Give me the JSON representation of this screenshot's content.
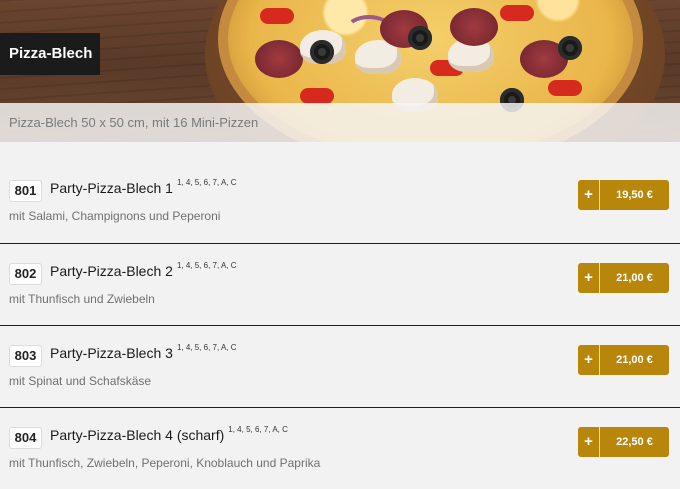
{
  "category": {
    "title": "Pizza-Blech",
    "subtitle": "Pizza-Blech 50 x 50 cm, mit 16 Mini-Pizzen"
  },
  "theme": {
    "accent": "#b8860b",
    "tag_bg": "#1b1b1b"
  },
  "icons": {
    "add": "plus-icon",
    "hero": "pizza-photo"
  },
  "items": [
    {
      "number": "801",
      "name": "Party-Pizza-Blech 1",
      "allergens": "1, 4, 5, 6, 7, A, C",
      "description": "mit Salami, Champignons und Peperoni",
      "plus": "+",
      "price": "19,50 €"
    },
    {
      "number": "802",
      "name": "Party-Pizza-Blech 2",
      "allergens": "1, 4, 5, 6, 7, A, C",
      "description": "mit Thunfisch und Zwiebeln",
      "plus": "+",
      "price": "21,00 €"
    },
    {
      "number": "803",
      "name": "Party-Pizza-Blech 3",
      "allergens": "1, 4, 5, 6, 7, A, C",
      "description": "mit Spinat und Schafskäse",
      "plus": "+",
      "price": "21,00 €"
    },
    {
      "number": "804",
      "name": "Party-Pizza-Blech 4 (scharf)",
      "allergens": "1, 4, 5, 6, 7, A, C",
      "description": "mit Thunfisch, Zwiebeln, Peperoni, Knoblauch und Paprika",
      "plus": "+",
      "price": "22,50 €"
    }
  ]
}
